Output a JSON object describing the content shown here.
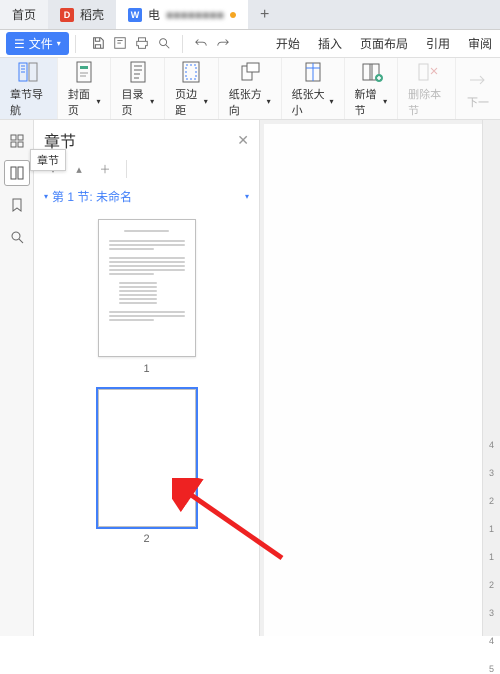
{
  "tabs": {
    "home": "首页",
    "daoqiao": "稻壳",
    "doc": "电",
    "plus": "+"
  },
  "menu": {
    "file": "文件",
    "begin": "开始",
    "insert": "插入",
    "pageLayout": "页面布局",
    "references": "引用",
    "review": "审阅"
  },
  "ribbon": {
    "chapterNav": "章节导航",
    "cover": "封面页",
    "toc": "目录页",
    "border": "页边距",
    "orientation": "纸张方向",
    "size": "纸张大小",
    "newSection": "新增节",
    "delSection": "删除本节",
    "nextSection": "下一"
  },
  "panel": {
    "title": "章节"
  },
  "tooltip": {
    "chapter": "章节"
  },
  "section": {
    "label": "第 1 节: 未命名"
  },
  "thumbs": {
    "p1": "1",
    "p2": "2"
  },
  "ruler": [
    "4",
    "3",
    "2",
    "1",
    "1",
    "2",
    "3",
    "4",
    "5"
  ]
}
